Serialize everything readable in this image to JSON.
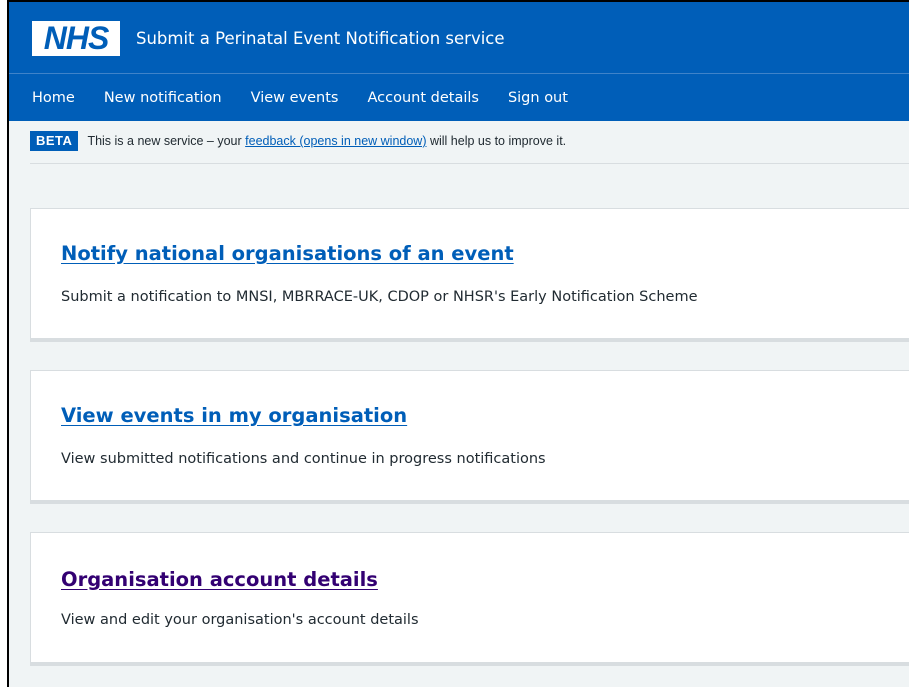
{
  "header": {
    "logo_text": "NHS",
    "service_name": "Submit a Perinatal Event Notification service"
  },
  "nav": {
    "items": [
      {
        "label": "Home"
      },
      {
        "label": "New notification"
      },
      {
        "label": "View events"
      },
      {
        "label": "Account details"
      },
      {
        "label": "Sign out"
      }
    ]
  },
  "beta_banner": {
    "tag": "BETA",
    "text_before": "This is a new service – your ",
    "link": "feedback (opens in new window)",
    "text_after": " will help us to improve it."
  },
  "cards": [
    {
      "title": "Notify national organisations of an event",
      "description": "Submit a notification to MNSI, MBRRACE-UK, CDOP or NHSR's Early Notification Scheme"
    },
    {
      "title": "View events in my organisation",
      "description": "View submitted notifications and continue in progress notifications"
    },
    {
      "title": "Organisation account details",
      "description": "View and edit your organisation's account details"
    }
  ],
  "colors": {
    "brand_blue": "#005eb8",
    "visited_link": "#330072",
    "page_background": "#f0f4f5"
  }
}
